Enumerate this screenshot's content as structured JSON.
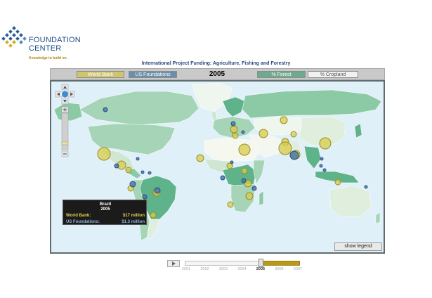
{
  "logo": {
    "name_line1": "FOUNDATION",
    "name_line2": "CENTER",
    "tagline": "Knowledge to build on."
  },
  "title": "International Project Funding: Agriculture, Fishing and Forestry",
  "toolbar": {
    "world_bank": "World Bank",
    "us_foundations": "US Foundations",
    "year": "2005",
    "forest": "% Forest",
    "cropland": "% Cropland"
  },
  "colors": {
    "world_bank": "#d8cc4a",
    "us_foundations": "#4a78ae",
    "ocean": "#dff0f8",
    "forest_low": "#dfeedd",
    "forest_mid": "#a6d4b6",
    "forest_high": "#5fb38a",
    "selected_year": "#b89a18"
  },
  "tooltip": {
    "country": "Brazil",
    "year": "2005",
    "world_bank_label": "World Bank:",
    "world_bank_value": "$17 million",
    "us_foundations_label": "US Foundations:",
    "us_foundations_value": "$1.3 million"
  },
  "legend_button": "show legend",
  "timeline": {
    "years": [
      "2001",
      "2002",
      "2003",
      "2004",
      "2005",
      "2006",
      "2007"
    ],
    "selected": "2005",
    "range_end": "2007"
  },
  "map_controls": [
    "pan-up",
    "pan-left",
    "globe-home",
    "pan-right",
    "pan-down",
    "zoom-in",
    "zoom-slider",
    "zoom-out"
  ]
}
